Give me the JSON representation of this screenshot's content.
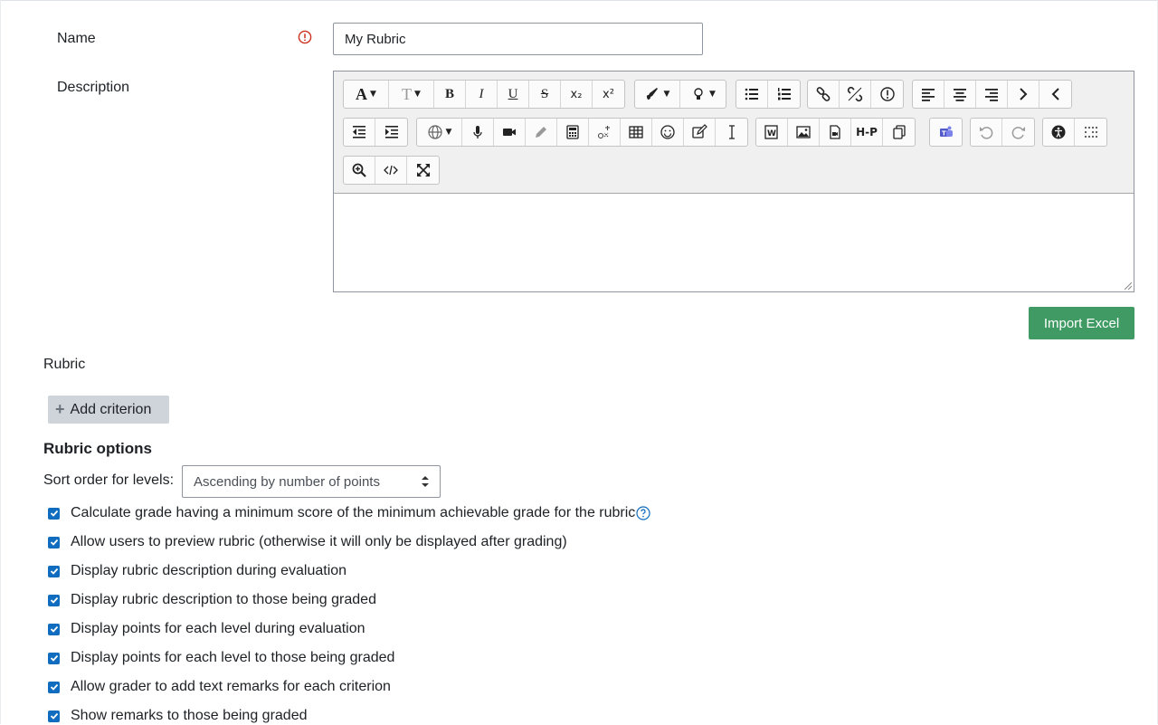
{
  "form": {
    "name_label": "Name",
    "name_value": "My Rubric",
    "description_label": "Description",
    "import_button": "Import Excel",
    "rubric_label": "Rubric",
    "add_criterion_button": "Add criterion",
    "options_title": "Rubric options",
    "sort_label": "Sort order for levels:",
    "sort_value": "Ascending by number of points"
  },
  "editor": {
    "toolbar_icons": [
      "font-family-icon",
      "font-size-icon",
      "bold-icon",
      "italic-icon",
      "underline-icon",
      "strikethrough-icon",
      "subscript-icon",
      "superscript-icon",
      "font-color-icon",
      "highlight-icon",
      "bullet-list-icon",
      "numbered-list-icon",
      "link-icon",
      "unlink-icon",
      "no-autolink-icon",
      "align-left-icon",
      "align-center-icon",
      "align-right-icon",
      "ltr-icon",
      "rtl-icon",
      "outdent-icon",
      "indent-icon",
      "language-icon",
      "record-audio-icon",
      "record-video-icon",
      "draw-icon",
      "calculator-icon",
      "equation-icon",
      "table-icon",
      "emoticon-icon",
      "edit-icon",
      "text-cursor-icon",
      "word-import-icon",
      "image-icon",
      "media-icon",
      "h5p-icon",
      "copy-icon",
      "teams-icon",
      "undo-icon",
      "redo-icon",
      "accessibility-checker-icon",
      "screenreader-helper-icon",
      "zoom-icon",
      "html-source-icon",
      "fullscreen-icon"
    ],
    "labels": {
      "bold": "B",
      "italic": "I",
      "underline": "U",
      "strike": "S",
      "sub": "x₂",
      "sup": "x²",
      "h5p": "H-P"
    }
  },
  "options": [
    {
      "label": "Calculate grade having a minimum score of the minimum achievable grade for the rubric",
      "checked": true,
      "help": true
    },
    {
      "label": "Allow users to preview rubric (otherwise it will only be displayed after grading)",
      "checked": true
    },
    {
      "label": "Display rubric description during evaluation",
      "checked": true
    },
    {
      "label": "Display rubric description to those being graded",
      "checked": true
    },
    {
      "label": "Display points for each level during evaluation",
      "checked": true
    },
    {
      "label": "Display points for each level to those being graded",
      "checked": true
    },
    {
      "label": "Allow grader to add text remarks for each criterion",
      "checked": true
    },
    {
      "label": "Show remarks to those being graded",
      "checked": true
    }
  ],
  "colors": {
    "primary": "#0f6cbf",
    "success": "#3f9b63",
    "required": "#ca3120",
    "secondary_btn": "#ced4da"
  }
}
